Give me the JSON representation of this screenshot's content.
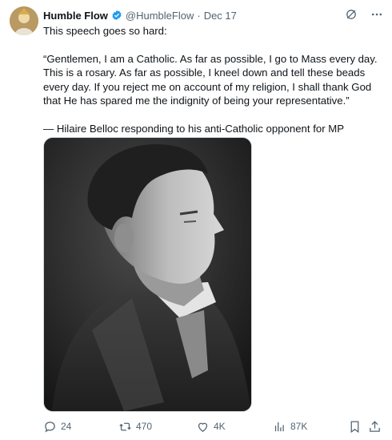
{
  "author": {
    "name": "Humble Flow",
    "handle": "@HumbleFlow",
    "separator": "·",
    "date": "Dec 17",
    "verified_color": "#1d9bf0"
  },
  "post": {
    "intro": "This speech goes so hard:",
    "quote": "“Gentlemen, I am a Catholic. As far as possible, I go to Mass every day. This is a rosary. As far as possible, I kneel down and tell these beads every day. If you reject me on account of my religion, I shall thank God that He has spared me the indignity of being your representative.”",
    "attribution": "— Hilaire Belloc responding to his anti-Catholic opponent for MP"
  },
  "icons": {
    "grok": "grok-icon",
    "more": "more-icon"
  },
  "actions": {
    "replies": "24",
    "reposts": "470",
    "likes": "4K",
    "views": "87K"
  }
}
